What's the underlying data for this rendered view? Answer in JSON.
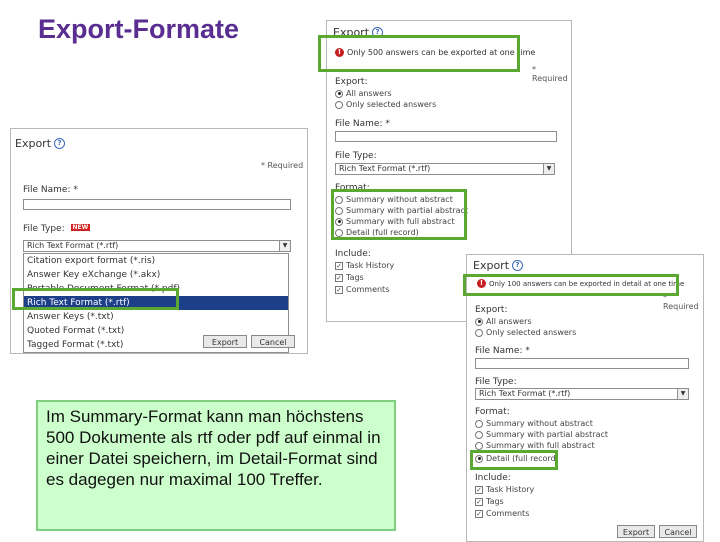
{
  "slide": {
    "title": "Export-Formate",
    "note": "Im Summary-Format kann man höchstens 500 Dokumente als rtf oder pdf auf einmal in einer Datei speichern, im Detail-Format sind es dagegen nur maximal 100 Treffer."
  },
  "left_panel": {
    "header": "Export",
    "required": "* Required",
    "file_name_label": "File Name: *",
    "file_type_label": "File Type:",
    "new_badge": "NEW",
    "selected_type": "Rich Text Format (*.rtf)",
    "options": [
      "Citation export format (*.ris)",
      "Answer Key eXchange (*.akx)",
      "Portable Document Format (*.pdf)",
      "Rich Text Format (*.rtf)",
      "Answer Keys (*.txt)",
      "Quoted Format (*.txt)",
      "Tagged Format (*.txt)"
    ],
    "selected_index": 3,
    "export_button": "Export",
    "cancel_button": "Cancel"
  },
  "mid_panel": {
    "header": "Export",
    "warning": "Only 500 answers can be exported at one time",
    "required": "* Required",
    "export_label": "Export:",
    "export_options": [
      "All answers",
      "Only selected answers"
    ],
    "file_name_label": "File Name: *",
    "file_type_label": "File Type:",
    "file_type_value": "Rich Text Format (*.rtf)",
    "format_label": "Format:",
    "format_options": [
      "Summary without abstract",
      "Summary with partial abstract",
      "Summary with full abstract",
      "Detail (full record)"
    ],
    "include_label": "Include:",
    "include_options": [
      "Task History",
      "Tags",
      "Comments"
    ]
  },
  "right_panel": {
    "header": "Export",
    "warning": "Only 100 answers can be exported in detail at one time",
    "required": "* Required",
    "export_label": "Export:",
    "export_options": [
      "All answers",
      "Only selected answers"
    ],
    "file_name_label": "File Name: *",
    "file_type_label": "File Type:",
    "file_type_value": "Rich Text Format (*.rtf)",
    "format_label": "Format:",
    "format_options": [
      "Summary without abstract",
      "Summary with partial abstract",
      "Summary with full abstract",
      "Detail (full record)"
    ],
    "include_label": "Include:",
    "include_options": [
      "Task History",
      "Tags",
      "Comments"
    ],
    "export_button": "Export",
    "cancel_button": "Cancel"
  },
  "colors": {
    "title": "#5a2d91",
    "highlight": "#5aa832",
    "note_bg": "#ccffcc",
    "dropdown_selected": "#1d3f8a",
    "warning": "#c62020"
  }
}
